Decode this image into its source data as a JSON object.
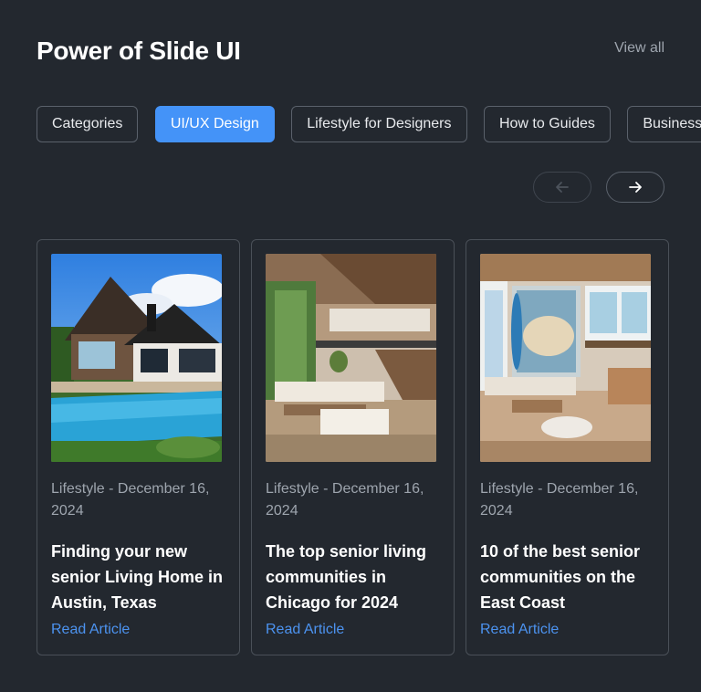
{
  "header": {
    "title": "Power of Slide UI",
    "view_all": "View all"
  },
  "categories": [
    {
      "label": "Categories",
      "active": false
    },
    {
      "label": "UI/UX Design",
      "active": true
    },
    {
      "label": "Lifestyle for Designers",
      "active": false
    },
    {
      "label": "How to Guides",
      "active": false
    },
    {
      "label": "Business",
      "active": false
    }
  ],
  "nav": {
    "prev_icon": "arrow-left-icon",
    "next_icon": "arrow-right-icon"
  },
  "articles": [
    {
      "image": "modern-house-pool-photo",
      "meta": "Lifestyle - December 16, 2024",
      "title": "Finding your new senior Living Home in Austin, Texas",
      "link": "Read Article"
    },
    {
      "image": "two-story-living-room-photo",
      "meta": "Lifestyle - December 16, 2024",
      "title": "The top senior living communities in Chicago for 2024",
      "link": "Read Article"
    },
    {
      "image": "coastal-living-room-photo",
      "meta": "Lifestyle - December 16, 2024",
      "title": "10 of the best senior communities on the East Coast",
      "link": "Read Article"
    }
  ],
  "colors": {
    "background": "#23282f",
    "accent": "#4493f8",
    "link": "#4c93f0",
    "muted_text": "#9ea5ae"
  }
}
